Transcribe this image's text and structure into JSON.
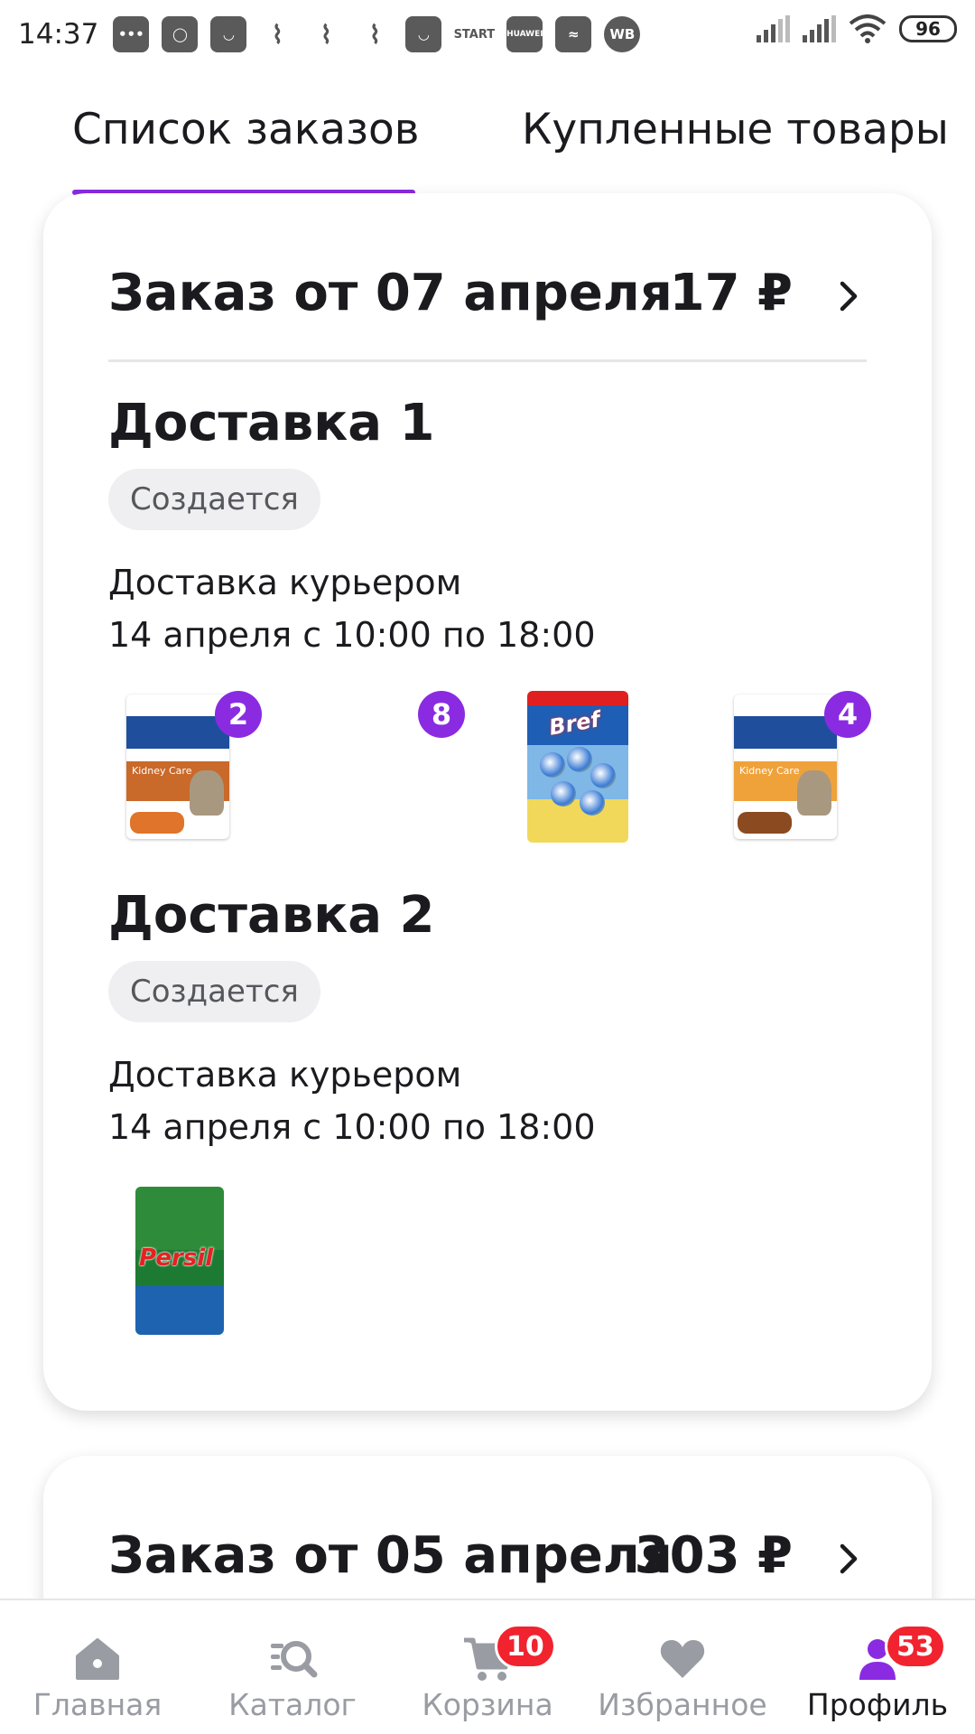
{
  "status_bar": {
    "time": "14:37",
    "notification_labels": [
      "START",
      "HUAWEI",
      "WB"
    ],
    "battery": "96"
  },
  "tabs": [
    {
      "label": "Список заказов",
      "active": true
    },
    {
      "label": "Купленные товары",
      "active": false
    }
  ],
  "accent_color": "#8a2be2",
  "orders": [
    {
      "title": "Заказ от 07 апреля",
      "price": "17 ₽",
      "deliveries": [
        {
          "title": "Доставка 1",
          "status": "Создается",
          "method": "Доставка курьером",
          "time": "14 апреля с 10:00 по 18:00",
          "products": [
            {
              "image": "hills-kidney-care-pouch-chicken",
              "count": "2"
            },
            {
              "image": "empty-product-image",
              "count": "8"
            },
            {
              "image": "bref-toilet-blocks",
              "count": ""
            },
            {
              "image": "hills-kidney-care-pouch-beef",
              "count": "4"
            }
          ]
        },
        {
          "title": "Доставка 2",
          "status": "Создается",
          "method": "Доставка курьером",
          "time": "14 апреля с 10:00 по 18:00",
          "products": [
            {
              "image": "persil-detergent",
              "count": ""
            }
          ]
        }
      ]
    },
    {
      "title": "Заказ от 05 апреля",
      "price": "303 ₽"
    }
  ],
  "product_texts": {
    "pouch_label": "Kidney Care",
    "bref_logo": "Bref",
    "persil_logo": "Persil"
  },
  "bottom_nav": [
    {
      "label": "Главная",
      "icon": "home-icon",
      "badge": ""
    },
    {
      "label": "Каталог",
      "icon": "catalog-search-icon",
      "badge": ""
    },
    {
      "label": "Корзина",
      "icon": "cart-icon",
      "badge": "10"
    },
    {
      "label": "Избранное",
      "icon": "heart-icon",
      "badge": ""
    },
    {
      "label": "Профиль",
      "icon": "profile-icon",
      "badge": "53",
      "active": true
    }
  ]
}
